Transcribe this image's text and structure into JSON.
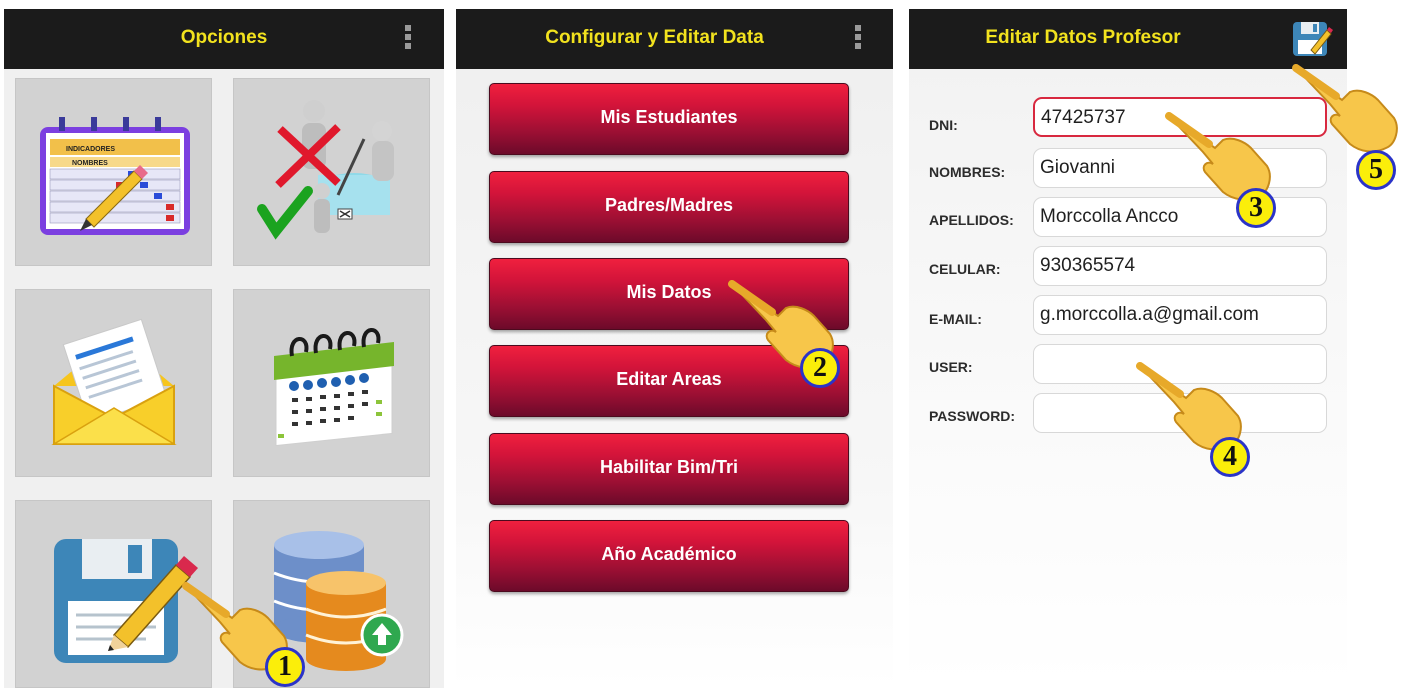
{
  "panel_options": {
    "title": "Opciones",
    "tiles": [
      {
        "icon": "gradebook-calendar-icon"
      },
      {
        "icon": "evaluation-people-icon"
      },
      {
        "icon": "mail-envelope-icon"
      },
      {
        "icon": "calendar-icon"
      },
      {
        "icon": "save-edit-icon"
      },
      {
        "icon": "database-upload-icon"
      }
    ],
    "gradebook_header": "INDICADORES",
    "gradebook_names": "NOMBRES"
  },
  "panel_config": {
    "title": "Configurar y Editar Data",
    "buttons": [
      "Mis Estudiantes",
      "Padres/Madres",
      "Mis Datos",
      "Editar Areas",
      "Habilitar Bim/Tri",
      "Año Académico"
    ]
  },
  "panel_edit": {
    "title": "Editar Datos Profesor",
    "fields": [
      {
        "label": "DNI:",
        "value": "47425737"
      },
      {
        "label": "NOMBRES:",
        "value": "Giovanni"
      },
      {
        "label": "APELLIDOS:",
        "value": "Morccolla Ancco"
      },
      {
        "label": "CELULAR:",
        "value": "930365574"
      },
      {
        "label": "E-MAIL:",
        "value": "g.morccolla.a@gmail.com"
      },
      {
        "label": "USER:",
        "value": ""
      },
      {
        "label": "PASSWORD:",
        "value": ""
      }
    ]
  },
  "step_badges": [
    "1",
    "2",
    "3",
    "4",
    "5"
  ],
  "colors": {
    "title_yellow": "#f2e21e",
    "button_red": "#d3143a",
    "badge_yellow": "#fbee0a",
    "badge_border": "#2b34c8",
    "active_border": "#d8283f"
  }
}
